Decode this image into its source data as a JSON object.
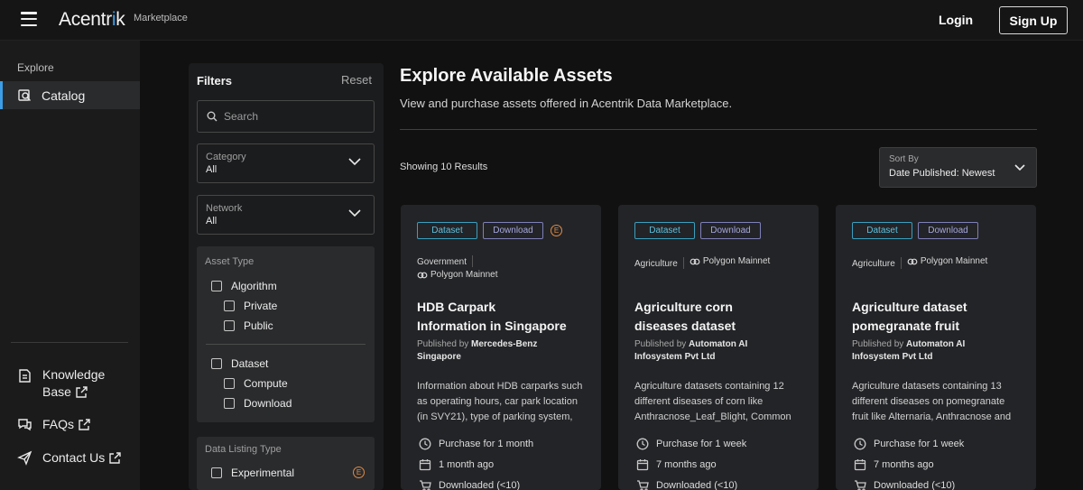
{
  "header": {
    "logo_main": "Acentr",
    "logo_accent": "i",
    "logo_end": "k",
    "logo_sub": "Marketplace",
    "login_label": "Login",
    "signup_label": "Sign Up"
  },
  "sidebar": {
    "heading": "Explore",
    "active_item": "Catalog",
    "links": [
      {
        "label_line1": "Knowledge",
        "label_line2": "Base",
        "icon": "book-icon"
      },
      {
        "label_line1": "FAQs",
        "icon": "chat-icon"
      },
      {
        "label_line1": "Contact Us",
        "icon": "send-icon"
      }
    ]
  },
  "filters": {
    "title": "Filters",
    "reset": "Reset",
    "search_placeholder": "Search",
    "category": {
      "caption": "Category",
      "value": "All"
    },
    "network": {
      "caption": "Network",
      "value": "All"
    },
    "asset_type": {
      "caption": "Asset Type",
      "algorithm": "Algorithm",
      "private": "Private",
      "public": "Public",
      "dataset": "Dataset",
      "compute": "Compute",
      "download": "Download"
    },
    "listing_type": {
      "caption": "Data Listing Type",
      "experimental": "Experimental",
      "badge": "E"
    }
  },
  "main": {
    "title": "Explore Available Assets",
    "subtitle": "View and purchase assets offered in Acentrik Data Marketplace.",
    "showing": "Showing 10 Results",
    "sort": {
      "caption": "Sort By",
      "value": "Date Published: Newest"
    }
  },
  "cards": [
    {
      "tag1": "Dataset",
      "tag2": "Download",
      "badge": "E",
      "category": "Government",
      "network": "Polygon Mainnet",
      "title_line1": "HDB Carpark",
      "title_line2": "Information in Singapore",
      "published_prefix": "Published by",
      "publisher_line1": "Mercedes-Benz",
      "publisher_line2": "Singapore",
      "description": "Information about HDB carparks such as operating hours, car park location (in SVY21), type of parking system, etc.",
      "duration": "Purchase for 1 month",
      "age": "1 month ago",
      "downloads": "Downloaded (<10)"
    },
    {
      "tag1": "Dataset",
      "tag2": "Download",
      "category": "Agriculture",
      "network": "Polygon Mainnet",
      "title_line1": "Agriculture corn",
      "title_line2": "diseases dataset",
      "published_prefix": "Published by",
      "publisher_line1": "Automaton AI",
      "publisher_line2": "Infosystem Pvt Ltd",
      "description": "Agriculture datasets containing 12 different diseases of corn like Anthracnose_Leaf_Blight, Common rust and more.",
      "duration": "Purchase for 1 week",
      "age": "7 months ago",
      "downloads": "Downloaded (<10)"
    },
    {
      "tag1": "Dataset",
      "tag2": "Download",
      "category": "Agriculture",
      "network": "Polygon Mainnet",
      "title_line1": "Agriculture dataset",
      "title_line2": "pomegranate fruit",
      "published_prefix": "Published by",
      "publisher_line1": "Automaton AI",
      "publisher_line2": "Infosystem Pvt Ltd",
      "description": "Agriculture datasets containing 13 different diseases on pomegranate fruit like Alternaria, Anthracnose and more.",
      "duration": "Purchase for 1 week",
      "age": "7 months ago",
      "downloads": "Downloaded (<10)"
    }
  ],
  "colors": {
    "accent": "#3b9ee6",
    "background": "#111111",
    "card": "#232427",
    "experimental_badge": "#e08a45"
  }
}
